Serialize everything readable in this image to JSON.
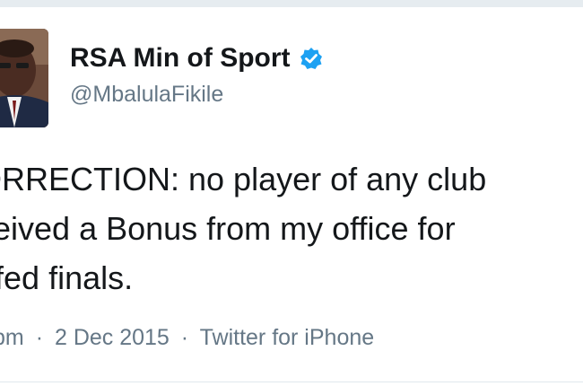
{
  "user": {
    "display_name": "RSA Min of Sport",
    "handle": "@MbalulaFikile",
    "verified_icon": "verified-badge-icon",
    "verified_color": "#1da1f2"
  },
  "tweet": {
    "lines": [
      "ORRECTION: no player of any club",
      "ceived a Bonus from my office for",
      "nfed finals."
    ]
  },
  "meta": {
    "time": "pm",
    "date": "2 Dec 2015",
    "source": "Twitter for iPhone",
    "separator": "·"
  }
}
